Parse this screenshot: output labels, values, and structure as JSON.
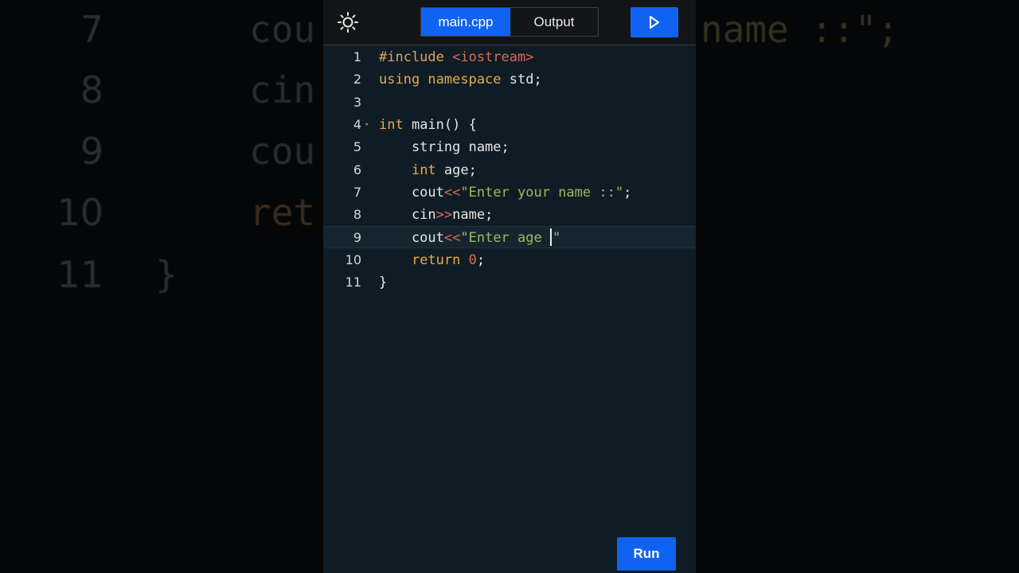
{
  "background": {
    "lines": [
      {
        "num": "7",
        "code": "cou",
        "tail": "name ::\";"
      },
      {
        "num": "8",
        "code": "cin"
      },
      {
        "num": "9",
        "code": "cou"
      },
      {
        "num": "10",
        "code": "ret"
      },
      {
        "num": "11",
        "code": "}"
      }
    ]
  },
  "toolbar": {
    "theme_icon": "sun-icon",
    "tabs": [
      {
        "label": "main.cpp",
        "active": true
      },
      {
        "label": "Output",
        "active": false
      }
    ],
    "play_icon": "play-icon"
  },
  "editor": {
    "current_line": 9,
    "lines": [
      {
        "n": "1",
        "tokens": [
          [
            "pre",
            "#include "
          ],
          [
            "inc",
            "<iostream>"
          ]
        ]
      },
      {
        "n": "2",
        "tokens": [
          [
            "kw",
            "using namespace "
          ],
          [
            "plain",
            "std;"
          ]
        ]
      },
      {
        "n": "3",
        "tokens": []
      },
      {
        "n": "4",
        "fold": true,
        "tokens": [
          [
            "kw",
            "int "
          ],
          [
            "plain",
            "main() {"
          ]
        ]
      },
      {
        "n": "5",
        "tokens": [
          [
            "plain",
            "    string name;"
          ]
        ]
      },
      {
        "n": "6",
        "tokens": [
          [
            "plain",
            "    "
          ],
          [
            "kw",
            "int "
          ],
          [
            "plain",
            "age;"
          ]
        ]
      },
      {
        "n": "7",
        "tokens": [
          [
            "plain",
            "    cout"
          ],
          [
            "op",
            "<<"
          ],
          [
            "str",
            "\"Enter your name ::\""
          ],
          [
            "plain",
            ";"
          ]
        ]
      },
      {
        "n": "8",
        "tokens": [
          [
            "plain",
            "    cin"
          ],
          [
            "op",
            ">>"
          ],
          [
            "plain",
            "name;"
          ]
        ]
      },
      {
        "n": "9",
        "tokens": [
          [
            "plain",
            "    cout"
          ],
          [
            "op",
            "<<"
          ],
          [
            "str",
            "\"Enter age "
          ],
          [
            "cursor",
            ""
          ],
          [
            "str",
            "\""
          ]
        ]
      },
      {
        "n": "10",
        "tokens": [
          [
            "plain",
            "    "
          ],
          [
            "kw",
            "return "
          ],
          [
            "num",
            "0"
          ],
          [
            "plain",
            ";"
          ]
        ]
      },
      {
        "n": "11",
        "tokens": [
          [
            "plain",
            "}"
          ]
        ]
      }
    ]
  },
  "run_button": {
    "label": "Run"
  },
  "colors": {
    "accent": "#1063f0",
    "editor_bg": "#0f1c25",
    "keyword": "#e8ab4a",
    "string": "#a4b85a",
    "operator": "#e06a52"
  }
}
